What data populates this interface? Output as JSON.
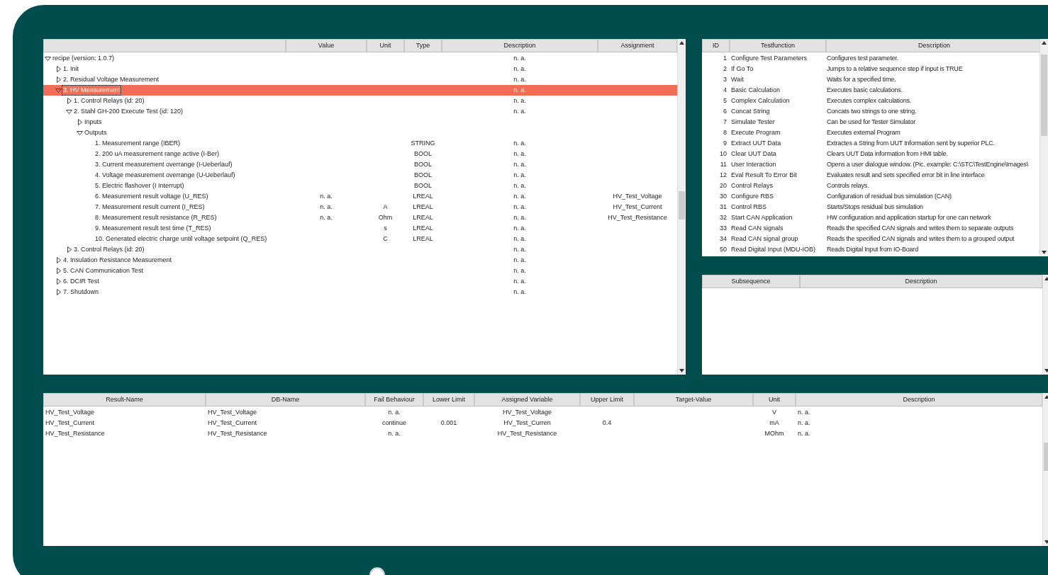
{
  "tree": {
    "columns": [
      "Value",
      "Unit",
      "Type",
      "Description",
      "Assignment"
    ],
    "nodes": [
      {
        "label": "recipe (version: 1.0.7)",
        "expanded": true,
        "selected": false,
        "description": "n. a.",
        "children": [
          {
            "label": "1. Init",
            "expanded": false,
            "selected": false,
            "description": "n. a."
          },
          {
            "label": "2. Residual Voltage Measurement",
            "expanded": false,
            "selected": false,
            "description": "n. a."
          },
          {
            "label": "3. HV Measurement",
            "expanded": true,
            "selected": true,
            "description": "n. a.",
            "children": [
              {
                "label": "1. Control Relays (id: 20)",
                "expanded": false,
                "selected": false,
                "description": "n. a."
              },
              {
                "label": "2. Stahl GH-200 Execute Test (id: 120)",
                "expanded": true,
                "selected": false,
                "description": "n. a.",
                "children": [
                  {
                    "label": "Inputs",
                    "expanded": false,
                    "selected": false
                  },
                  {
                    "label": "Outputs",
                    "expanded": true,
                    "selected": false,
                    "children": [
                      {
                        "label": "1. Measurement range (IBER)",
                        "selected": false,
                        "type": "STRING",
                        "description": "n. a."
                      },
                      {
                        "label": "2. 200 uA measurement range active (I-Ber)",
                        "selected": false,
                        "type": "BOOL",
                        "description": "n. a."
                      },
                      {
                        "label": "3. Current measurement overrange (I-Ueberlauf)",
                        "selected": false,
                        "type": "BOOL",
                        "description": "n. a."
                      },
                      {
                        "label": "4. Voltage measurement overrange (U-Ueberlauf)",
                        "selected": false,
                        "type": "BOOL",
                        "description": "n. a."
                      },
                      {
                        "label": "5. Electric flashover (I Interrupt)",
                        "selected": false,
                        "type": "BOOL",
                        "description": "n. a."
                      },
                      {
                        "label": "6. Measurement result voltage (U_RES)",
                        "selected": false,
                        "value": "n. a.",
                        "type": "LREAL",
                        "description": "n. a.",
                        "assignment": "HV_Test_Voltage"
                      },
                      {
                        "label": "7. Measurement result current (I_RES)",
                        "selected": false,
                        "value": "n. a.",
                        "unit": "A",
                        "type": "LREAL",
                        "description": "n. a.",
                        "assignment": "HV_Test_Current"
                      },
                      {
                        "label": "8. Measurement result resistance (R_RES)",
                        "selected": false,
                        "value": "n. a.",
                        "unit": "Ohm",
                        "type": "LREAL",
                        "description": "n. a.",
                        "assignment": "HV_Test_Resistance"
                      },
                      {
                        "label": "9. Measurement result test time (T_RES)",
                        "selected": false,
                        "unit": "s",
                        "type": "LREAL",
                        "description": "n. a."
                      },
                      {
                        "label": "10. Generated electric charge until voltage setpoint (Q_RES)",
                        "selected": false,
                        "unit": "C",
                        "type": "LREAL",
                        "description": "n. a."
                      }
                    ]
                  }
                ]
              },
              {
                "label": "3. Control Relays (id: 20)",
                "expanded": false,
                "selected": false,
                "description": "n. a."
              }
            ]
          },
          {
            "label": "4. Insulation Resistance Measurement",
            "expanded": false,
            "selected": false,
            "description": "n. a."
          },
          {
            "label": "5. CAN Communication Test",
            "expanded": false,
            "selected": false,
            "description": "n. a."
          },
          {
            "label": "6. DCIR Test",
            "expanded": false,
            "selected": false,
            "description": "n. a."
          },
          {
            "label": "7. Shutdown",
            "expanded": false,
            "selected": false,
            "description": "n. a."
          }
        ]
      }
    ]
  },
  "testfunctions": {
    "columns": [
      "ID",
      "Testfunction",
      "Description"
    ],
    "rows": [
      {
        "id": "1",
        "name": "Configure Test Parameters",
        "description": "Configures test parameter."
      },
      {
        "id": "2",
        "name": "If Go To",
        "description": "Jumps to a relative sequence step if input is TRUE"
      },
      {
        "id": "3",
        "name": "Wait",
        "description": "Waits for a specified time."
      },
      {
        "id": "4",
        "name": "Basic Calculation",
        "description": "Executes basic calculations."
      },
      {
        "id": "5",
        "name": "Complex Calculation",
        "description": "Executes complex calculations."
      },
      {
        "id": "6",
        "name": "Concat String",
        "description": "Concats two strings to one string."
      },
      {
        "id": "7",
        "name": "Simulate Tester",
        "description": "Can be used for Tester Simulator"
      },
      {
        "id": "8",
        "name": "Execute Program",
        "description": "Executes external Program"
      },
      {
        "id": "9",
        "name": "Extract UUT Data",
        "description": "Extractes a String from UUT Information sent by superior PLC."
      },
      {
        "id": "10",
        "name": "Clear UUT Data",
        "description": "Clears UUT Data information from HMI table."
      },
      {
        "id": "11",
        "name": "User Interaction",
        "description": "Opens a user dialogue window. (Pic. example: C:\\STC\\TestEngine\\Images\\"
      },
      {
        "id": "12",
        "name": "Eval Result To Error Bit",
        "description": "Evaluates result and sets specified error bit in line interface"
      },
      {
        "id": "20",
        "name": "Control Relays",
        "description": "Controls relays."
      },
      {
        "id": "30",
        "name": "Configure RBS",
        "description": "Configuration of residual bus simulation (CAN)"
      },
      {
        "id": "31",
        "name": "Control RBS",
        "description": "Starts/Stops residual bus simulation"
      },
      {
        "id": "32",
        "name": "Start CAN Application",
        "description": "HW configuration and application startup for one can network"
      },
      {
        "id": "33",
        "name": "Read CAN signals",
        "description": "Reads the specified CAN signals and writes them to separate outputs"
      },
      {
        "id": "34",
        "name": "Read CAN signal group",
        "description": "Reads the specified CAN signals and writes them to a grouped output"
      },
      {
        "id": "50",
        "name": "Read Digital Input (MDU-IOB)",
        "description": "Reads Digital Input from IO-Board"
      }
    ]
  },
  "subsequences": {
    "columns": [
      "Subsequence",
      "Description"
    ]
  },
  "results": {
    "columns": [
      "Result-Name",
      "DB-Name",
      "Fail Behaviour",
      "Lower Limit",
      "Assigned Variable",
      "Upper Limit",
      "Target-Value",
      "Unit",
      "Description"
    ],
    "rows": [
      {
        "result_name": "HV_Test_Voltage",
        "db_name": "HV_Test_Voltage",
        "fail_behaviour": "n. a.",
        "assigned_variable": "HV_Test_Voltage",
        "unit": "V",
        "description": "n. a."
      },
      {
        "result_name": "HV_Test_Current",
        "db_name": "HV_Test_Current",
        "fail_behaviour": "continue",
        "lower_limit": "0.001",
        "assigned_variable": "HV_Test_Curren",
        "upper_limit": "0.4",
        "unit": "mA",
        "description": "n. a."
      },
      {
        "result_name": "HV_Test_Resistance",
        "db_name": "HV_Test_Resistance",
        "fail_behaviour": "n. a.",
        "assigned_variable": "HV_Test_Resistance",
        "unit": "MOhm",
        "description": "n. a."
      }
    ]
  }
}
